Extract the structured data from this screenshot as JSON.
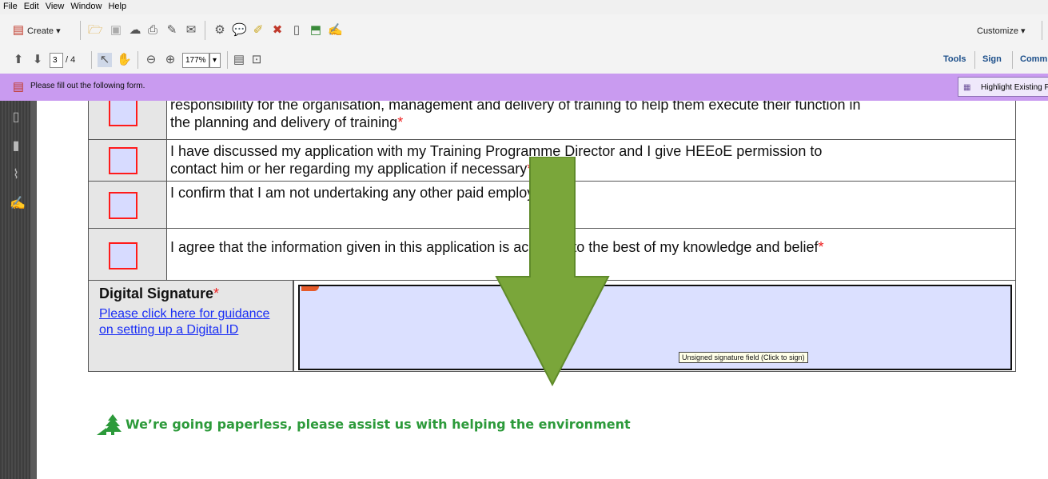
{
  "menu": [
    "File",
    "Edit",
    "View",
    "Window",
    "Help"
  ],
  "toolbar": {
    "create_label": "Create",
    "customize_label": "Customize",
    "page_current": "3",
    "page_total": "/ 4",
    "zoom": "177%",
    "tools_label": "Tools",
    "sign_label": "Sign",
    "comment_label": "Comm"
  },
  "formbar": {
    "message": "Please fill out the following form.",
    "highlight_button": "Highlight Existing Fi"
  },
  "declarations": [
    {
      "line1": "responsibility for the organisation, management and delivery of training to help them execute their function in",
      "line2": "the planning and delivery of training",
      "required": "*"
    },
    {
      "line1": "I have discussed my application with my Training Programme Director and I give HEEoE permission to",
      "line2": "contact him or her regarding my application if necessary",
      "required": "*"
    },
    {
      "line1": "I confirm that I am not undertaking any other paid employment",
      "line2": "",
      "required": "*"
    },
    {
      "line1": "I agree that the information given in this application is accurate to the best of my knowledge and belief",
      "line2": "",
      "required": "*"
    }
  ],
  "signature": {
    "title": "Digital Signature",
    "required": "*",
    "link_text": "Please click here for guidance on setting up a Digital ID",
    "tooltip": "Unsigned signature field (Click to sign)"
  },
  "eco_message": "We’re going paperless, please assist us with helping the environment",
  "colors": {
    "form_bar": "#c99bf0",
    "checkbox_border": "#ff1b1b",
    "field_fill": "#dbe0ff",
    "arrow": "#7aa63a",
    "eco_text": "#2c9a3a"
  }
}
